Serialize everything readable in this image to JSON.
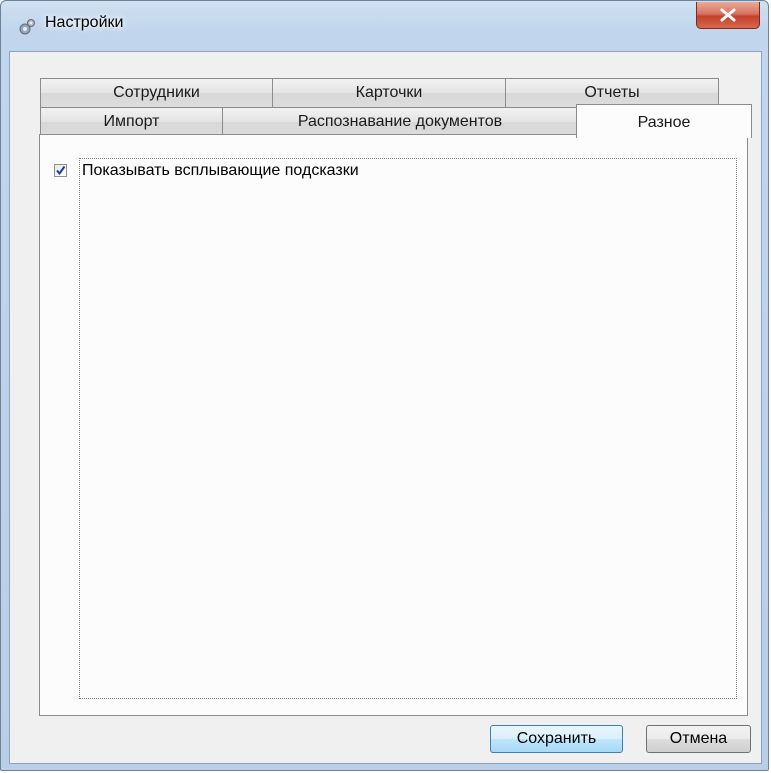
{
  "window": {
    "title": "Настройки",
    "icon": "gear-icon",
    "close_icon": "close-icon"
  },
  "tabs": {
    "row1": [
      {
        "label": "Сотрудники"
      },
      {
        "label": "Карточки"
      },
      {
        "label": "Отчеты"
      }
    ],
    "row2": [
      {
        "label": "Импорт"
      },
      {
        "label": "Распознавание документов"
      },
      {
        "label": "Разное",
        "selected": true
      }
    ]
  },
  "content": {
    "show_tooltips": {
      "label": "Показывать всплывающие подсказки",
      "checked": true
    }
  },
  "buttons": {
    "save": "Сохранить",
    "cancel": "Отмена"
  },
  "colors": {
    "close_button": "#c4402a",
    "default_button_border": "#3c7fb1",
    "check_mark": "#1c3f94"
  }
}
